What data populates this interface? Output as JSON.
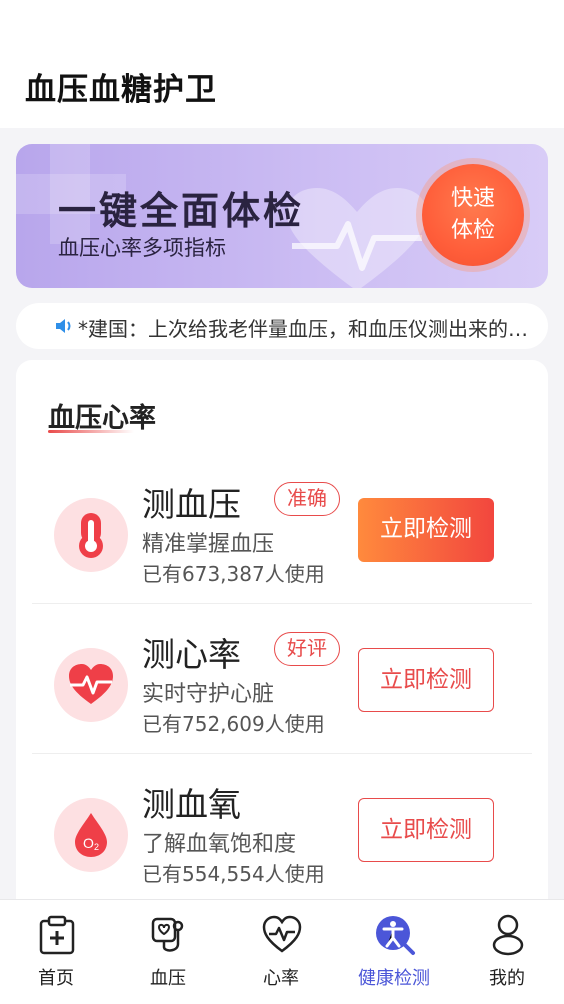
{
  "header": {
    "title": "血压血糖护卫"
  },
  "banner": {
    "title": "一键全面体检",
    "subtitle": "血压心率多项指标",
    "quick_button_line1": "快速",
    "quick_button_line2": "体检",
    "accent": "#ff5e3a"
  },
  "notice": {
    "text": "*建国：上次给我老伴量血压，和血压仪测出来的数值差不多"
  },
  "section": {
    "title": "血压心率",
    "items": [
      {
        "name": "测血压",
        "badge": "准确",
        "desc": "精准掌握血压",
        "count": "已有673,387人使用",
        "button": "立即检测",
        "icon": "thermometer-icon"
      },
      {
        "name": "测心率",
        "badge": "好评",
        "desc": "实时守护心脏",
        "count": "已有752,609人使用",
        "button": "立即检测",
        "icon": "heart-pulse-icon"
      },
      {
        "name": "测血氧",
        "badge": "",
        "desc": "了解血氧饱和度",
        "count": "已有554,554人使用",
        "button": "立即检测",
        "icon": "blood-drop-o2-icon"
      }
    ]
  },
  "tabbar": {
    "tabs": [
      {
        "label": "首页",
        "icon": "medical-clipboard-icon"
      },
      {
        "label": "血压",
        "icon": "stethoscope-icon"
      },
      {
        "label": "心率",
        "icon": "heart-rate-icon"
      },
      {
        "label": "健康检测",
        "icon": "health-check-icon",
        "active": true
      },
      {
        "label": "我的",
        "icon": "profile-icon"
      }
    ],
    "active_color": "#4b56d8"
  },
  "colors": {
    "primary_red": "#e84b4b",
    "banner_purple": "#c5b6f2"
  }
}
